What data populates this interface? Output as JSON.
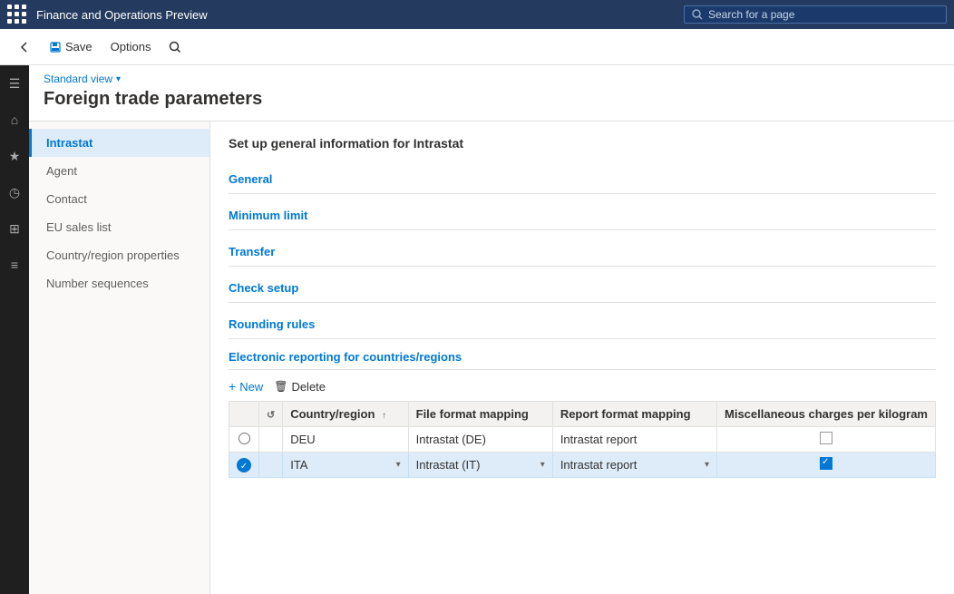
{
  "app": {
    "title": "Finance and Operations Preview"
  },
  "search": {
    "placeholder": "Search for a page"
  },
  "toolbar": {
    "back_label": "",
    "save_label": "Save",
    "options_label": "Options",
    "search_icon": "🔍"
  },
  "page": {
    "view_label": "Standard view",
    "title": "Foreign trade parameters"
  },
  "left_nav": {
    "items": [
      {
        "id": "intrastat",
        "label": "Intrastat",
        "active": true
      },
      {
        "id": "agent",
        "label": "Agent",
        "active": false
      },
      {
        "id": "contact",
        "label": "Contact",
        "active": false
      },
      {
        "id": "eu_sales_list",
        "label": "EU sales list",
        "active": false
      },
      {
        "id": "country_region",
        "label": "Country/region properties",
        "active": false
      },
      {
        "id": "number_sequences",
        "label": "Number sequences",
        "active": false
      }
    ]
  },
  "panel": {
    "title": "Set up general information for Intrastat",
    "sections": [
      {
        "id": "general",
        "label": "General"
      },
      {
        "id": "minimum_limit",
        "label": "Minimum limit"
      },
      {
        "id": "transfer",
        "label": "Transfer"
      },
      {
        "id": "check_setup",
        "label": "Check setup"
      },
      {
        "id": "rounding_rules",
        "label": "Rounding rules"
      }
    ],
    "er_section": {
      "title": "Electronic reporting for countries/regions",
      "new_label": "New",
      "delete_label": "Delete",
      "table": {
        "columns": [
          {
            "id": "select",
            "label": ""
          },
          {
            "id": "reload",
            "label": ""
          },
          {
            "id": "country_region",
            "label": "Country/region"
          },
          {
            "id": "sort_icon",
            "label": "↑"
          },
          {
            "id": "file_format",
            "label": "File format mapping"
          },
          {
            "id": "report_format",
            "label": "Report format mapping"
          },
          {
            "id": "misc_charges",
            "label": "Miscellaneous charges per kilogram"
          }
        ],
        "rows": [
          {
            "id": "row1",
            "selected": false,
            "country": "DEU",
            "file_format": "Intrastat (DE)",
            "report_format": "Intrastat report",
            "misc_charges_checked": false
          },
          {
            "id": "row2",
            "selected": true,
            "country": "ITA",
            "file_format": "Intrastat (IT)",
            "report_format": "Intrastat report",
            "misc_charges_checked": true
          }
        ]
      }
    }
  },
  "side_icons": [
    {
      "id": "menu",
      "symbol": "☰"
    },
    {
      "id": "home",
      "symbol": "⌂"
    },
    {
      "id": "favorites",
      "symbol": "★"
    },
    {
      "id": "recent",
      "symbol": "◷"
    },
    {
      "id": "workspaces",
      "symbol": "⊞"
    },
    {
      "id": "modules",
      "symbol": "≡"
    }
  ]
}
